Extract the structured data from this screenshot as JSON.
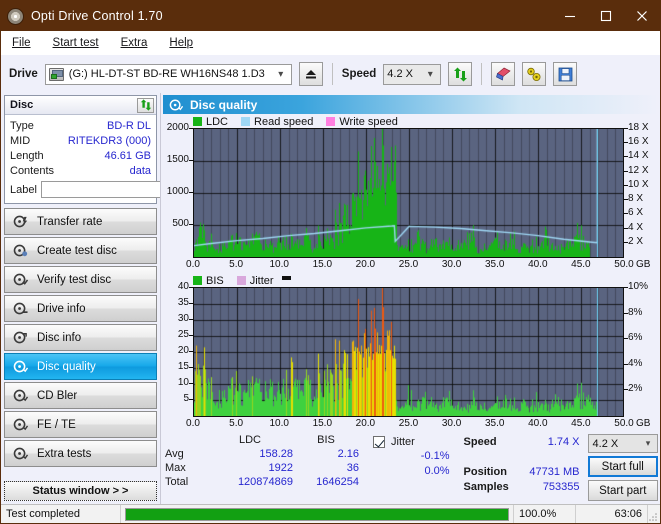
{
  "window": {
    "title": "Opti Drive Control 1.70",
    "icon": "disc-icon",
    "minimize": "minimize-icon",
    "maximize": "maximize-icon",
    "close": "close-icon"
  },
  "menu": {
    "items": [
      "File",
      "Start test",
      "Extra",
      "Help"
    ]
  },
  "toolbar": {
    "drive_label": "Drive",
    "drive_value": "(G:)   HL-DT-ST BD-RE  WH16NS48 1.D3",
    "eject_icon": "eject-icon",
    "speed_label": "Speed",
    "speed_value": "4.2 X",
    "refresh_icon": "refresh-icon",
    "erase_icon": "eraser-icon",
    "tools_icon": "wrench-icon",
    "save_icon": "save-icon"
  },
  "disc": {
    "title": "Disc",
    "refresh_icon": "refresh-icon",
    "rows": [
      {
        "key": "Type",
        "value": "BD-R DL"
      },
      {
        "key": "MID",
        "value": "RITEKDR3 (000)"
      },
      {
        "key": "Length",
        "value": "46.61 GB"
      },
      {
        "key": "Contents",
        "value": "data"
      }
    ],
    "label_key": "Label",
    "label_value": "",
    "label_placeholder": "",
    "disc_button_icon": "cd-icon"
  },
  "nav": {
    "items": [
      {
        "label": "Transfer rate",
        "icon": "disc-arrow-icon",
        "active": false
      },
      {
        "label": "Create test disc",
        "icon": "disc-write-icon",
        "active": false
      },
      {
        "label": "Verify test disc",
        "icon": "disc-check-icon",
        "active": false
      },
      {
        "label": "Drive info",
        "icon": "disc-info-icon",
        "active": false
      },
      {
        "label": "Disc info",
        "icon": "disc-info2-icon",
        "active": false
      },
      {
        "label": "Disc quality",
        "icon": "disc-quality-icon",
        "active": true
      },
      {
        "label": "CD Bler",
        "icon": "disc-bler-icon",
        "active": false
      },
      {
        "label": "FE / TE",
        "icon": "disc-fete-icon",
        "active": false
      },
      {
        "label": "Extra tests",
        "icon": "disc-extra-icon",
        "active": false
      }
    ],
    "status_window": "Status window > >"
  },
  "section": {
    "title": "Disc quality",
    "icon": "disc-quality-icon"
  },
  "chart_data": [
    {
      "type": "area",
      "id": "ldc-chart",
      "title": "",
      "xlabel": "GB",
      "ylabel": "",
      "legend": [
        {
          "label": "LDC",
          "color": "#17b417"
        },
        {
          "label": "Read speed",
          "color": "#9fd8f5"
        },
        {
          "label": "Write speed",
          "color": "#ff7fe0"
        }
      ],
      "legend_position": "top-left",
      "grid": true,
      "plot_bg": "#5a6480",
      "xlim": [
        0,
        50
      ],
      "xticks": [
        0.0,
        5.0,
        10.0,
        15.0,
        20.0,
        25.0,
        30.0,
        35.0,
        40.0,
        45.0,
        50.0
      ],
      "xticklabels": [
        "0.0",
        "5.0",
        "10.0",
        "15.0",
        "20.0",
        "25.0",
        "30.0",
        "35.0",
        "40.0",
        "45.0",
        "50.0"
      ],
      "ylim": [
        0,
        2000
      ],
      "yticks": [
        500,
        1000,
        1500,
        2000
      ],
      "yticklabels": [
        "500",
        "1000",
        "1500",
        "2000"
      ],
      "y2lim": [
        0,
        18
      ],
      "y2ticks": [
        2,
        4,
        6,
        8,
        10,
        12,
        14,
        16,
        18
      ],
      "y2ticklabels": [
        "2 X",
        "4 X",
        "6 X",
        "8 X",
        "10 X",
        "12 X",
        "14 X",
        "16 X",
        "18 X"
      ],
      "series": [
        {
          "name": "LDC",
          "color": "#17b417",
          "axis": "left",
          "x": [
            0.0,
            0.4,
            0.8,
            1.0,
            1.2,
            1.5,
            1.8,
            2.1,
            2.5,
            3.0,
            3.5,
            4.0,
            4.5,
            5.0,
            5.5,
            6.0,
            6.5,
            7.0,
            7.5,
            8.0,
            8.5,
            9.0,
            9.5,
            10.0,
            10.5,
            11.0,
            11.5,
            12.0,
            12.5,
            13.0,
            13.5,
            14.0,
            14.5,
            15.0,
            15.5,
            16.0,
            16.5,
            17.0,
            17.5,
            18.0,
            18.5,
            19.0,
            19.5,
            20.0,
            20.4,
            20.8,
            21.2,
            21.6,
            22.0,
            22.4,
            22.8,
            23.2,
            23.4,
            23.6,
            24.0,
            24.5,
            25.0,
            25.5,
            26.0,
            27.0,
            28.0,
            29.0,
            30.0,
            31.0,
            32.0,
            33.0,
            34.0,
            35.0,
            36.0,
            37.0,
            38.0,
            39.0,
            40.0,
            41.0,
            42.0,
            43.0,
            44.0,
            45.0,
            46.0,
            46.8
          ],
          "y": [
            180,
            260,
            640,
            720,
            480,
            300,
            250,
            240,
            230,
            220,
            300,
            250,
            230,
            260,
            400,
            230,
            250,
            460,
            300,
            240,
            280,
            230,
            250,
            420,
            260,
            230,
            250,
            300,
            230,
            500,
            260,
            240,
            330,
            260,
            420,
            300,
            560,
            700,
            900,
            780,
            1020,
            1160,
            1350,
            1600,
            1750,
            1920,
            1800,
            1870,
            1700,
            1780,
            1690,
            1800,
            1750,
            240,
            200,
            190,
            320,
            210,
            430,
            200,
            330,
            260,
            180,
            230,
            430,
            200,
            210,
            300,
            180,
            260,
            220,
            240,
            190,
            350,
            170,
            210,
            310,
            380,
            200
          ]
        },
        {
          "name": "Read speed",
          "color": "#9fd8f5",
          "axis": "right",
          "x": [
            0.0,
            2.0,
            5.0,
            8.0,
            11.0,
            14.0,
            17.0,
            20.0,
            23.0,
            23.3,
            23.4,
            25.0,
            28.0,
            31.0,
            34.0,
            37.0,
            40.0,
            43.0,
            46.0,
            46.9,
            46.9
          ],
          "y": [
            1.6,
            1.9,
            2.3,
            2.6,
            3.0,
            3.3,
            3.7,
            4.1,
            4.35,
            4.4,
            2.2,
            4.3,
            4.2,
            4.0,
            3.7,
            3.4,
            3.0,
            2.5,
            2.1,
            2.0,
            18.0
          ]
        }
      ]
    },
    {
      "type": "area",
      "id": "bis-chart",
      "title": "",
      "xlabel": "GB",
      "ylabel": "",
      "legend": [
        {
          "label": "BIS",
          "color": "#17b417"
        },
        {
          "label": "Jitter",
          "color": "#d9a8dc"
        }
      ],
      "legend_position": "top-left",
      "grid": true,
      "plot_bg": "#5a6480",
      "xlim": [
        0,
        50
      ],
      "xticks": [
        0.0,
        5.0,
        10.0,
        15.0,
        20.0,
        25.0,
        30.0,
        35.0,
        40.0,
        45.0,
        50.0
      ],
      "xticklabels": [
        "0.0",
        "5.0",
        "10.0",
        "15.0",
        "20.0",
        "25.0",
        "30.0",
        "35.0",
        "40.0",
        "45.0",
        "50.0"
      ],
      "ylim": [
        0,
        40
      ],
      "yticks": [
        5,
        10,
        15,
        20,
        25,
        30,
        35,
        40
      ],
      "yticklabels": [
        "5",
        "10",
        "15",
        "20",
        "25",
        "30",
        "35",
        "40"
      ],
      "y2lim": [
        0,
        10
      ],
      "y2ticks": [
        2,
        4,
        6,
        8,
        10
      ],
      "y2ticklabels": [
        "2%",
        "4%",
        "6%",
        "8%",
        "10%"
      ],
      "series": [
        {
          "name": "BIS",
          "color_low": "#3fd13f",
          "color_mid": "#e8e000",
          "color_high": "#ee5a11",
          "axis": "left",
          "x": [
            0.0,
            0.3,
            0.6,
            0.9,
            1.2,
            1.5,
            1.8,
            2.2,
            2.6,
            3.0,
            3.5,
            4.0,
            4.5,
            5.0,
            5.5,
            6.0,
            6.5,
            7.0,
            7.5,
            8.0,
            8.5,
            9.0,
            9.5,
            10.0,
            10.5,
            11.0,
            11.5,
            12.0,
            12.5,
            13.0,
            13.5,
            14.0,
            14.5,
            15.0,
            15.5,
            16.0,
            16.5,
            17.0,
            17.5,
            18.0,
            18.5,
            19.0,
            19.5,
            20.0,
            20.3,
            20.6,
            21.0,
            21.4,
            21.8,
            22.2,
            22.6,
            23.0,
            23.3,
            23.5,
            24.0,
            24.5,
            25.0,
            25.5,
            26.0,
            27.0,
            28.0,
            29.0,
            30.0,
            31.0,
            32.0,
            33.0,
            34.0,
            35.0,
            36.0,
            37.0,
            38.0,
            39.0,
            40.0,
            41.0,
            42.0,
            43.0,
            44.0,
            45.0,
            46.0,
            46.8
          ],
          "y": [
            8,
            21,
            13,
            12,
            29,
            19,
            9,
            7,
            8,
            9,
            10,
            9,
            8,
            10,
            12,
            9,
            10,
            14,
            9,
            11,
            10,
            12,
            9,
            13,
            11,
            10,
            14,
            12,
            10,
            16,
            11,
            10,
            13,
            12,
            15,
            14,
            17,
            19,
            22,
            18,
            24,
            26,
            28,
            32,
            30,
            35,
            34,
            33,
            36,
            30,
            34,
            28,
            26,
            4,
            3,
            4,
            12,
            3,
            5,
            8,
            4,
            6,
            5,
            3,
            4,
            7,
            3,
            4,
            5,
            3,
            6,
            4,
            5,
            3,
            7,
            4,
            5,
            8,
            6,
            3
          ]
        }
      ],
      "cursor_line": {
        "x": 46.9,
        "color": "#6fd4f7"
      }
    }
  ],
  "stats": {
    "columns": [
      "LDC",
      "BIS"
    ],
    "rows": [
      {
        "label": "Avg",
        "ldc": "158.28",
        "bis": "2.16"
      },
      {
        "label": "Max",
        "ldc": "1922",
        "bis": "36"
      },
      {
        "label": "Total",
        "ldc": "120874869",
        "bis": "1646254"
      }
    ],
    "jitter": {
      "label": "Jitter",
      "checked": true,
      "avg": "-0.1%",
      "max": "0.0%"
    },
    "speed": {
      "label": "Speed",
      "value": "1.74 X"
    },
    "position": {
      "label": "Position",
      "value": "47731 MB"
    },
    "samples": {
      "label": "Samples",
      "value": "753355"
    },
    "speed_select": "4.2 X",
    "start_full": "Start full",
    "start_part": "Start part"
  },
  "statusbar": {
    "message": "Test completed",
    "progress_percent": 100.0,
    "progress_text": "100.0%",
    "elapsed": "63:06"
  },
  "colors": {
    "titlebar": "#5a2d0c",
    "accent": "#1179d6",
    "value_text": "#2727cf",
    "plot_bg": "#5a6480",
    "ldc_green": "#17b417",
    "read_speed": "#9fd8f5",
    "write_speed": "#ff7fe0",
    "jitter": "#d9a8dc",
    "progress": "#12a012"
  }
}
